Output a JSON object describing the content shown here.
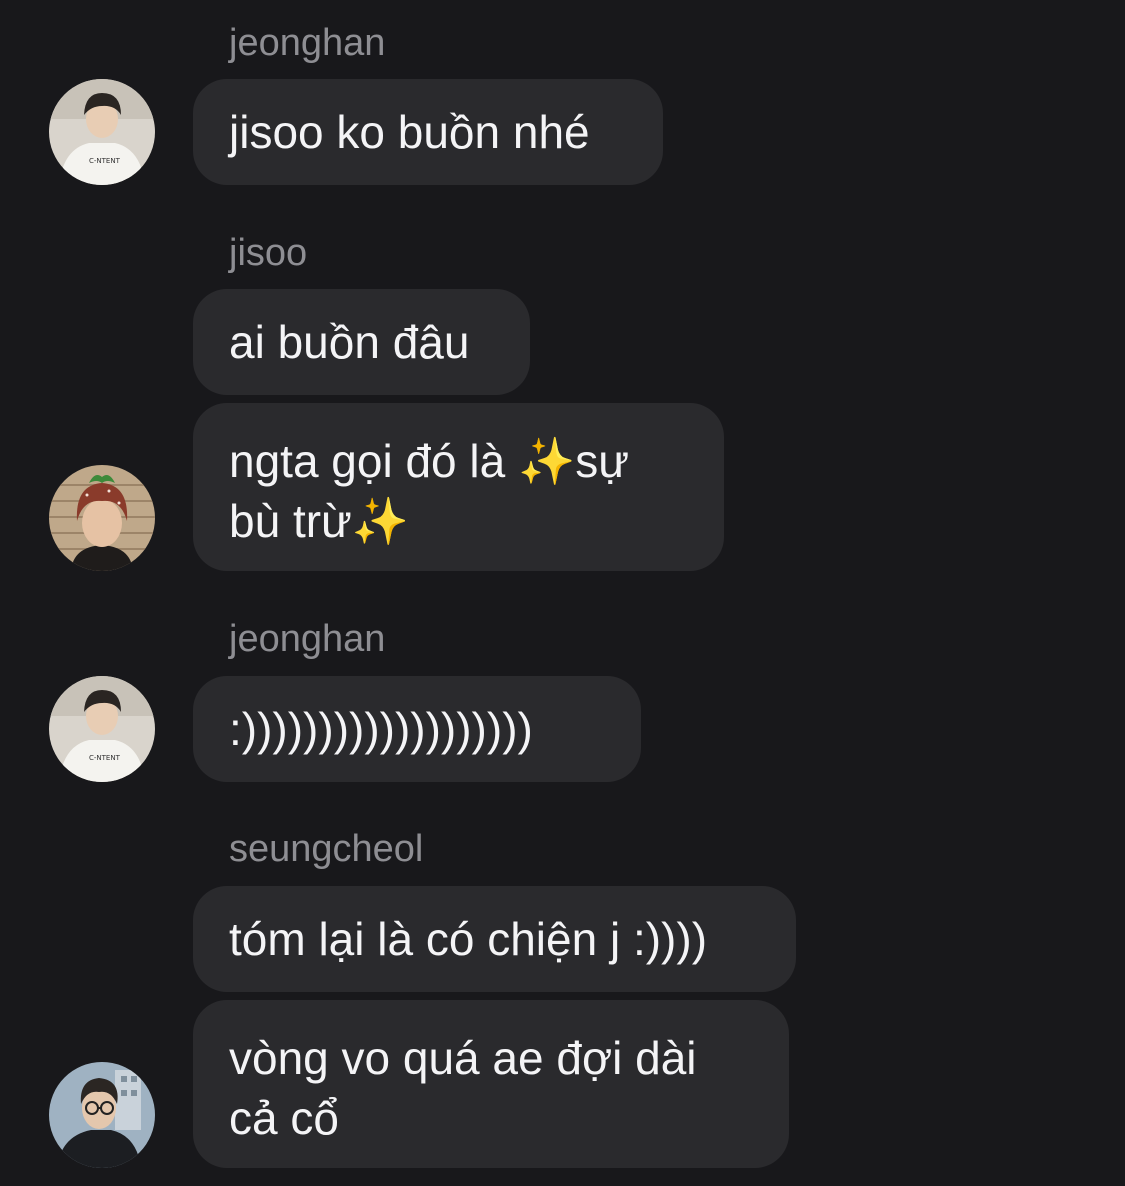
{
  "messages": [
    {
      "sender": "jeonghan",
      "bubbles": [
        {
          "text": "jisoo ko buồn nhé"
        }
      ],
      "avatar": "jeonghan-avatar",
      "avatar_shirt_text": "C-NTENT"
    },
    {
      "sender": "jisoo",
      "bubbles": [
        {
          "text": "ai buồn đâu"
        },
        {
          "line1_a": "ngta gọi đó là ",
          "sparkle1": "✨",
          "line1_b": "sự",
          "line2_a": "bù trừ",
          "sparkle2": "✨"
        }
      ],
      "avatar": "jisoo-avatar"
    },
    {
      "sender": "jeonghan",
      "bubbles": [
        {
          "text": ":)))))))))))))))))))"
        }
      ],
      "avatar": "jeonghan-avatar",
      "avatar_shirt_text": "C-NTENT"
    },
    {
      "sender": "seungcheol",
      "bubbles": [
        {
          "text": "tóm lại là có chiện j :))))"
        },
        {
          "line1": "vòng vo quá ae đợi dài",
          "line2": "cả cổ"
        }
      ],
      "avatar": "seungcheol-avatar"
    }
  ],
  "colors": {
    "background": "#18181b",
    "bubble": "#2a2a2d",
    "sender_text": "#8e8e93",
    "message_text": "#f4f4f6",
    "sparkle": "#f5c431"
  }
}
